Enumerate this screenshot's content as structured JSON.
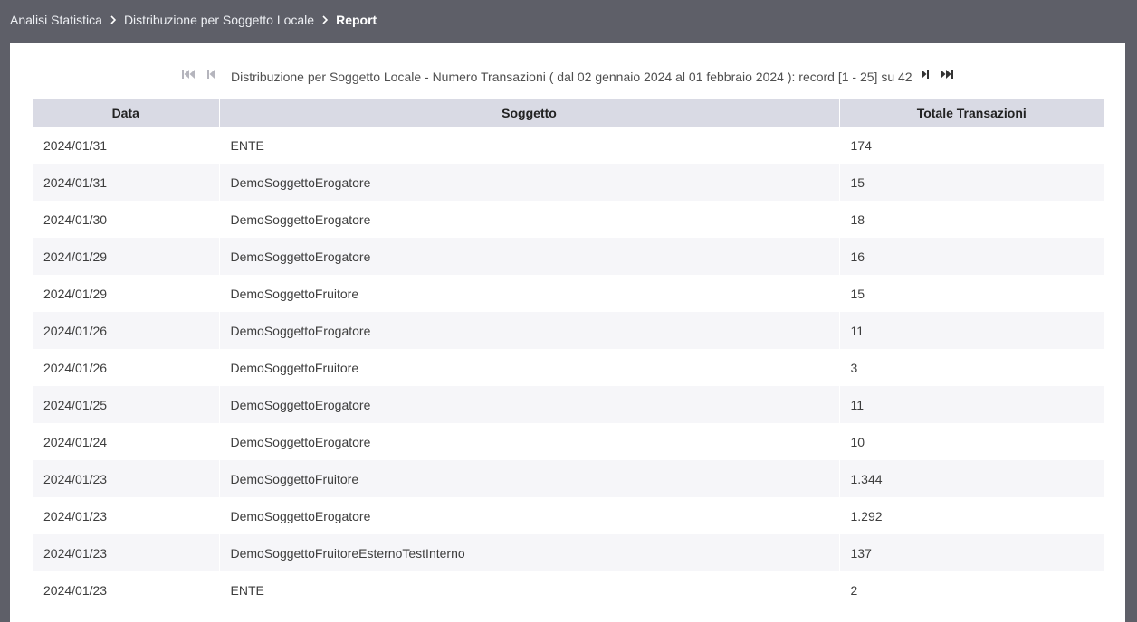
{
  "breadcrumb": {
    "items": [
      "Analisi Statistica",
      "Distribuzione per Soggetto Locale"
    ],
    "current": "Report"
  },
  "pager": {
    "info": "Distribuzione per Soggetto Locale - Numero Transazioni ( dal 02 gennaio 2024 al 01 febbraio 2024 ): record [1 - 25] su 42",
    "first_enabled": false,
    "prev_enabled": false,
    "next_enabled": true,
    "last_enabled": true
  },
  "table": {
    "headers": [
      "Data",
      "Soggetto",
      "Totale Transazioni"
    ],
    "rows": [
      [
        "2024/01/31",
        "ENTE",
        "174"
      ],
      [
        "2024/01/31",
        "DemoSoggettoErogatore",
        "15"
      ],
      [
        "2024/01/30",
        "DemoSoggettoErogatore",
        "18"
      ],
      [
        "2024/01/29",
        "DemoSoggettoErogatore",
        "16"
      ],
      [
        "2024/01/29",
        "DemoSoggettoFruitore",
        "15"
      ],
      [
        "2024/01/26",
        "DemoSoggettoErogatore",
        "11"
      ],
      [
        "2024/01/26",
        "DemoSoggettoFruitore",
        "3"
      ],
      [
        "2024/01/25",
        "DemoSoggettoErogatore",
        "11"
      ],
      [
        "2024/01/24",
        "DemoSoggettoErogatore",
        "10"
      ],
      [
        "2024/01/23",
        "DemoSoggettoFruitore",
        "1.344"
      ],
      [
        "2024/01/23",
        "DemoSoggettoErogatore",
        "1.292"
      ],
      [
        "2024/01/23",
        "DemoSoggettoFruitoreEsternoTestInterno",
        "137"
      ],
      [
        "2024/01/23",
        "ENTE",
        "2"
      ]
    ]
  },
  "colors": {
    "topbar_bg": "#5e5f68",
    "header_bg": "#d9dae4",
    "row_alt_bg": "#f6f6f9",
    "icon_disabled": "#b5b5bd",
    "icon_enabled": "#333333"
  }
}
